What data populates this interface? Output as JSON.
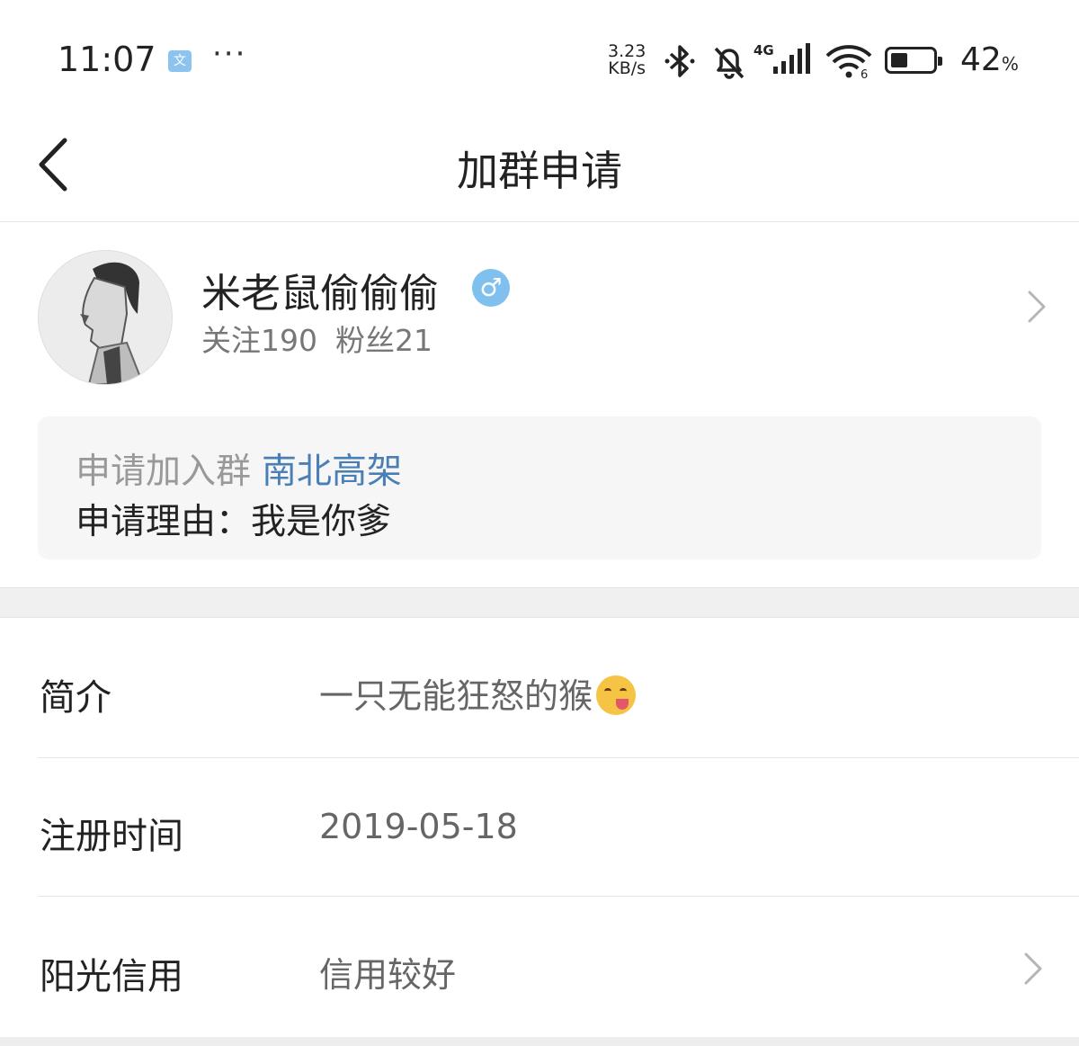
{
  "status_bar": {
    "time": "11:07",
    "app_icon_glyph": "文",
    "more": "···",
    "net_speed_value": "3.23",
    "net_speed_unit": "KB/s",
    "signal_type": "4G",
    "wifi_label": "6",
    "battery_level": 0.42,
    "battery_percent": "42",
    "battery_percent_unit": "%"
  },
  "nav": {
    "title": "加群申请"
  },
  "profile": {
    "name": "米老鼠偷偷偷",
    "gender_symbol": "♂",
    "following": "关注190",
    "followers": "粉丝21"
  },
  "request": {
    "prefix": "申请加入群",
    "group_name": "南北高架",
    "reason": "申请理由：我是你爹"
  },
  "info_rows": [
    {
      "label": "简介",
      "value": "一只无能狂怒的猴"
    },
    {
      "label": "注册时间",
      "value": "2019-05-18"
    },
    {
      "label": "阳光信用",
      "value": "信用较好"
    }
  ],
  "colors": {
    "accent_link": "#4a7fb5",
    "gender_badge": "#7fc0ef"
  }
}
